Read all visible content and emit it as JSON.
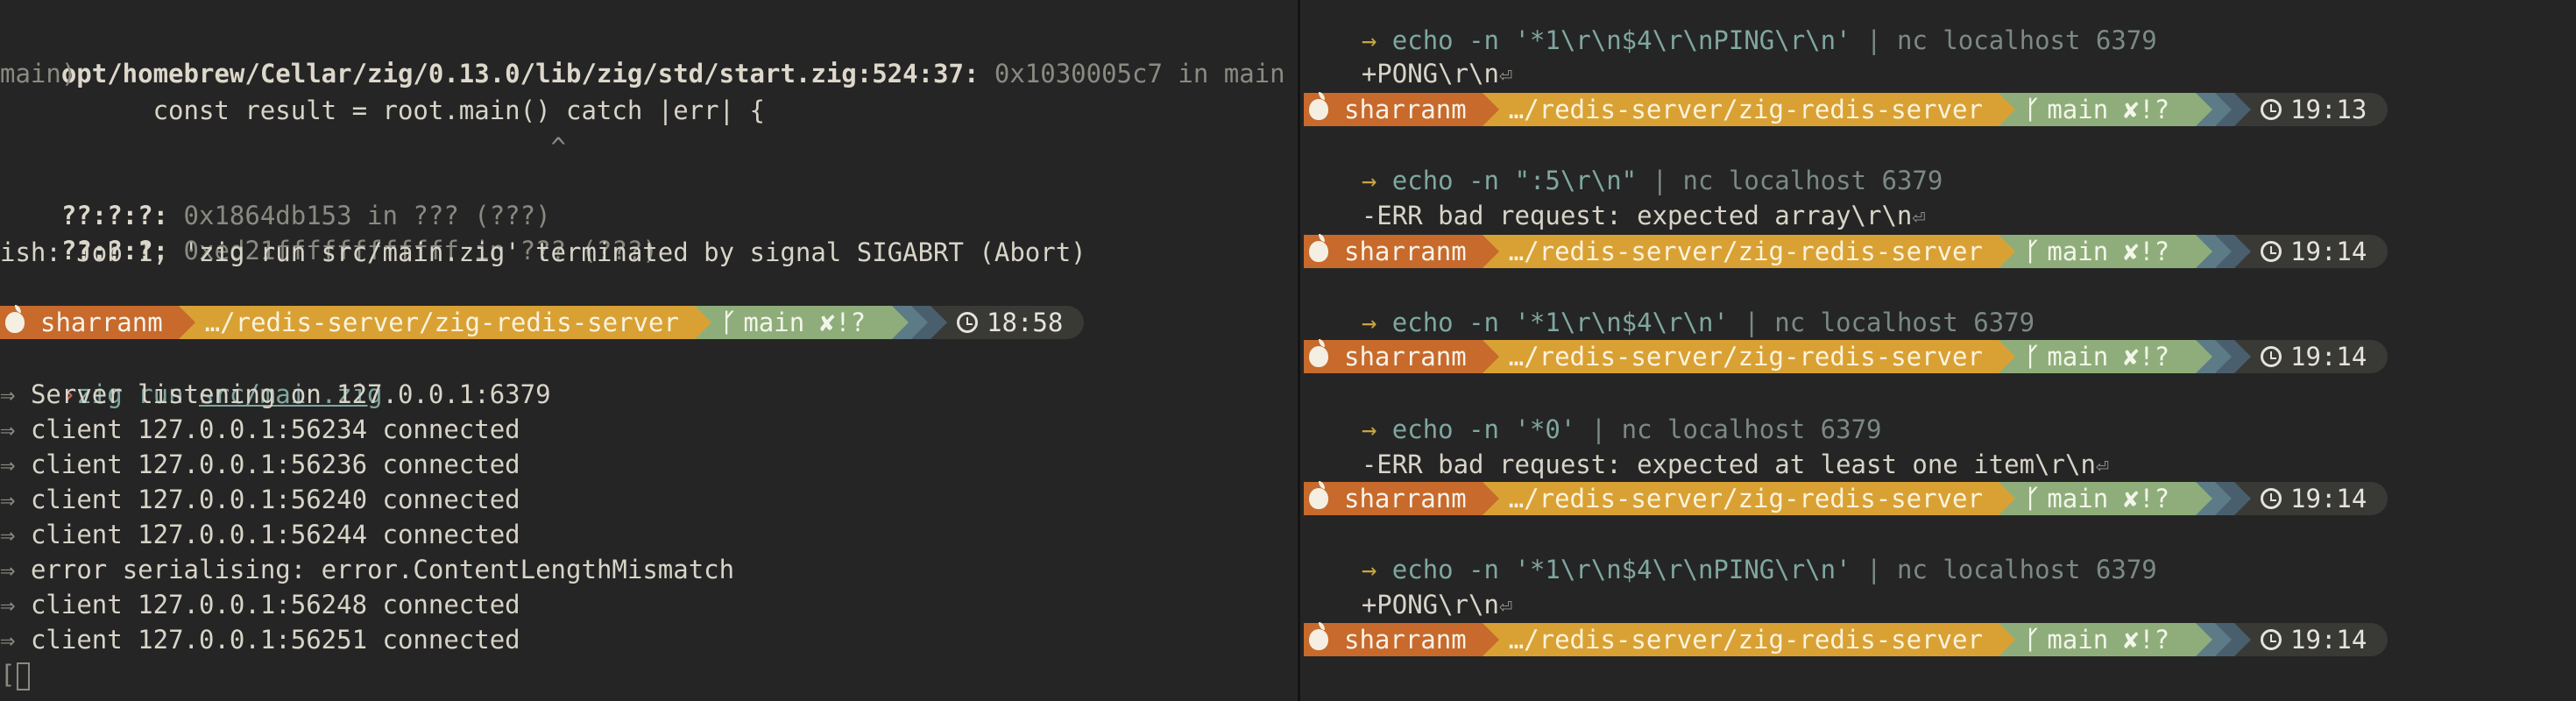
{
  "left_pane": {
    "lines": [
      {
        "text": "            ^"
      },
      {
        "path": "opt/homebrew/Cellar/zig/0.13.0/lib/zig/std/start.zig:524:37:",
        "rest": " 0x1030005c7 in main"
      },
      {
        "text": "main)"
      },
      {
        "text": "          const result = root.main() catch |err| {"
      },
      {
        "text": "                                    ^"
      },
      {
        "path": "??:?:?:",
        "rest": " 0x1864db153 in ??? (???)"
      },
      {
        "path": "??:?:?:",
        "rest": " 0xed21ffffffffffff in ??? (???)"
      },
      {
        "text": "ish: Job 1, 'zig run src/main.zig' terminated by signal SIGABRT (Abort)"
      }
    ],
    "prompt": {
      "user": "sharranm",
      "dir": "…/redis-server/zig-redis-server",
      "branch": "main",
      "status": "✘!?",
      "time": "18:58"
    },
    "command": {
      "prefix": "zig run ",
      "arg": "src/main.zig"
    },
    "output": [
      "Server listening on 127.0.0.1:6379",
      "client 127.0.0.1:56234 connected",
      "client 127.0.0.1:56236 connected",
      "client 127.0.0.1:56240 connected",
      "client 127.0.0.1:56244 connected",
      "error serialising: error.ContentLengthMismatch",
      "client 127.0.0.1:56248 connected",
      "client 127.0.0.1:56251 connected"
    ],
    "output_arrow": "⇒",
    "cursor_prefix": "["
  },
  "right_pane": {
    "arrow": "→",
    "top": {
      "command": "echo -n '*1\\r\\n$4\\r\\nPING\\r\\n'",
      "pipe": " | nc localhost 6379",
      "output": "+PONG\\r\\n"
    },
    "blocks": [
      {
        "prompt": {
          "user": "sharranm",
          "dir": "…/redis-server/zig-redis-server",
          "branch": "main",
          "status": "✘!?",
          "time": "19:13"
        },
        "command": "echo -n \":5\\r\\n\"",
        "pipe": " | nc localhost 6379",
        "output": "-ERR bad request: expected array\\r\\n"
      },
      {
        "prompt": {
          "user": "sharranm",
          "dir": "…/redis-server/zig-redis-server",
          "branch": "main",
          "status": "✘!?",
          "time": "19:14"
        },
        "command": "echo -n '*1\\r\\n$4\\r\\n'",
        "pipe": " | nc localhost 6379",
        "output": ""
      },
      {
        "prompt": {
          "user": "sharranm",
          "dir": "…/redis-server/zig-redis-server",
          "branch": "main",
          "status": "✘!?",
          "time": "19:14"
        },
        "command": "echo -n '*0'",
        "pipe": " | nc localhost 6379",
        "output": "-ERR bad request: expected at least one item\\r\\n"
      },
      {
        "prompt": {
          "user": "sharranm",
          "dir": "…/redis-server/zig-redis-server",
          "branch": "main",
          "status": "✘!?",
          "time": "19:14"
        },
        "command": "echo -n '*1\\r\\n$4\\r\\nPING\\r\\n'",
        "pipe": " | nc localhost 6379",
        "output": "+PONG\\r\\n"
      },
      {
        "prompt": {
          "user": "sharranm",
          "dir": "…/redis-server/zig-redis-server",
          "branch": "main",
          "status": "✘!?",
          "time": "19:14"
        },
        "command": "",
        "pipe": "",
        "output": ""
      }
    ]
  },
  "theme": {
    "background": "#252525",
    "user_segment": "#c76a2c",
    "dir_segment": "#d9a134",
    "git_segment": "#8fad7a",
    "time_segment": "#393936"
  }
}
